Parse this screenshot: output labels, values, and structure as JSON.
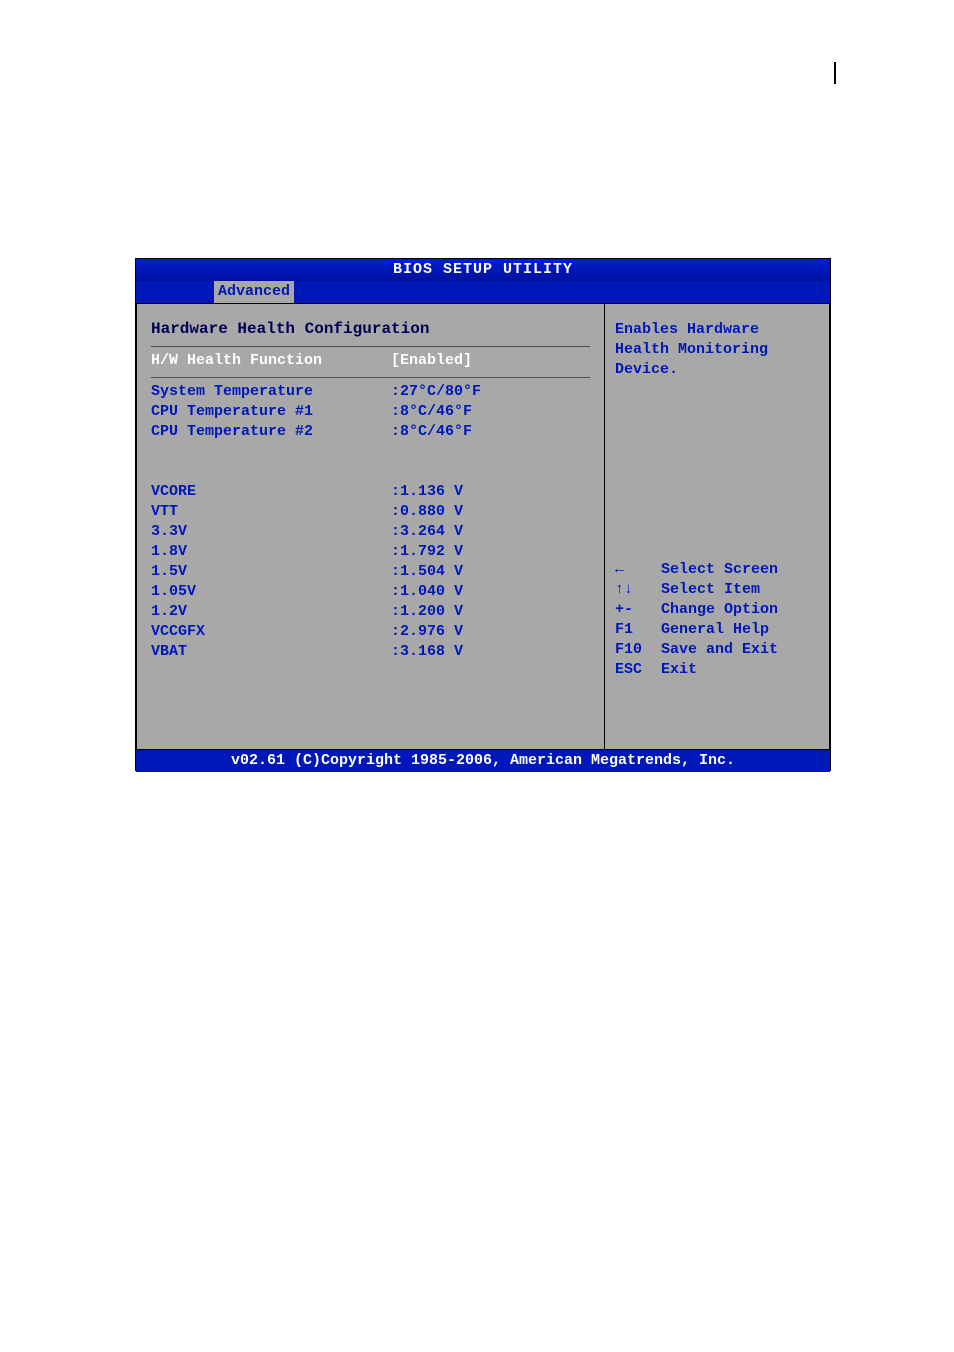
{
  "title": "BIOS SETUP UTILITY",
  "tab": "Advanced",
  "section_title": "Hardware Health Configuration",
  "setting": {
    "label": "H/W Health Function",
    "value": "[Enabled]"
  },
  "temps": [
    {
      "label": "System Temperature",
      "value": ":27°C/80°F"
    },
    {
      "label": "CPU Temperature #1",
      "value": ":8°C/46°F"
    },
    {
      "label": "CPU Temperature #2",
      "value": ":8°C/46°F"
    }
  ],
  "voltages": [
    {
      "label": "VCORE",
      "value": ":1.136 V"
    },
    {
      "label": "VTT",
      "value": ":0.880 V"
    },
    {
      "label": "3.3V",
      "value": ":3.264 V"
    },
    {
      "label": "1.8V",
      "value": ":1.792 V"
    },
    {
      "label": "1.5V",
      "value": ":1.504 V"
    },
    {
      "label": "1.05V",
      "value": ":1.040 V"
    },
    {
      "label": "1.2V",
      "value": ":1.200 V"
    },
    {
      "label": "VCCGFX",
      "value": ":2.976 V"
    },
    {
      "label": "VBAT",
      "value": ":3.168 V"
    }
  ],
  "help": {
    "line1": "Enables Hardware",
    "line2": "Health Monitoring",
    "line3": "Device."
  },
  "nav": [
    {
      "key": "←",
      "action": "Select Screen"
    },
    {
      "key": "↑↓",
      "action": "Select Item"
    },
    {
      "key": "+-",
      "action": "Change Option"
    },
    {
      "key": "F1",
      "action": "General Help"
    },
    {
      "key": "F10",
      "action": "Save and Exit"
    },
    {
      "key": "ESC",
      "action": "Exit"
    }
  ],
  "footer": "v02.61 (C)Copyright 1985-2006, American Megatrends, Inc."
}
